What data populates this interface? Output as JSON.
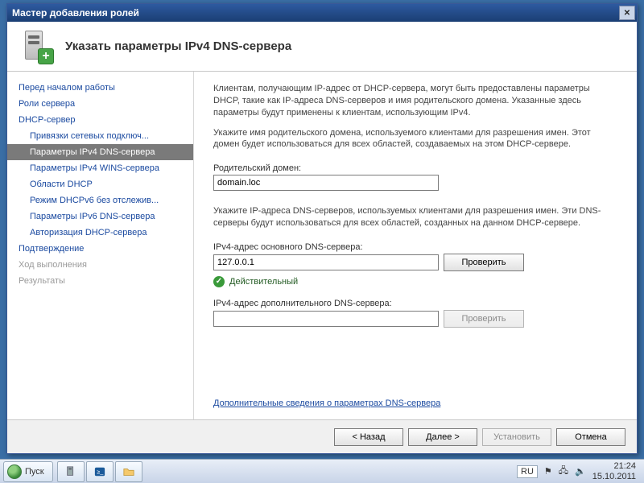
{
  "window": {
    "title": "Мастер добавления ролей",
    "close_glyph": "✕"
  },
  "header": {
    "title": "Указать параметры IPv4 DNS-сервера"
  },
  "sidebar": {
    "items": [
      {
        "label": "Перед началом работы",
        "sub": false
      },
      {
        "label": "Роли сервера",
        "sub": false
      },
      {
        "label": "DHCP-сервер",
        "sub": false
      },
      {
        "label": "Привязки сетевых подключ...",
        "sub": true
      },
      {
        "label": "Параметры IPv4 DNS-сервера",
        "sub": true,
        "selected": true
      },
      {
        "label": "Параметры IPv4 WINS-сервера",
        "sub": true
      },
      {
        "label": "Области DHCP",
        "sub": true
      },
      {
        "label": "Режим DHCPv6 без отслежив...",
        "sub": true
      },
      {
        "label": "Параметры IPv6 DNS-сервера",
        "sub": true
      },
      {
        "label": "Авторизация DHCP-сервера",
        "sub": true
      },
      {
        "label": "Подтверждение",
        "sub": false
      },
      {
        "label": "Ход выполнения",
        "sub": false,
        "disabled": true
      },
      {
        "label": "Результаты",
        "sub": false,
        "disabled": true
      }
    ]
  },
  "content": {
    "para1": "Клиентам, получающим IP-адрес от DHCP-сервера, могут быть предоставлены параметры DHCP, такие как IP-адреса DNS-серверов и имя родительского домена. Указанные здесь параметры будут применены к клиентам, использующим IPv4.",
    "para2": "Укажите имя родительского домена, используемого клиентами для разрешения имен. Этот домен будет использоваться для всех областей, создаваемых на этом DHCP-сервере.",
    "parent_domain_label": "Родительский домен:",
    "parent_domain_value": "domain.loc",
    "para3": "Укажите IP-адреса DNS-серверов, используемых клиентами для разрешения имен. Эти DNS-серверы будут использоваться для всех областей, созданных на данном DHCP-сервере.",
    "primary_label": "IPv4-адрес основного DNS-сервера:",
    "primary_value": "127.0.0.1",
    "verify_label": "Проверить",
    "valid_label": "Действительный",
    "secondary_label": "IPv4-адрес дополнительного DNS-сервера:",
    "secondary_value": "",
    "more_link": "Дополнительные сведения о параметрах DNS-сервера"
  },
  "footer": {
    "back": "< Назад",
    "next": "Далее >",
    "install": "Установить",
    "cancel": "Отмена"
  },
  "taskbar": {
    "start": "Пуск",
    "lang": "RU",
    "time": "21:24",
    "date": "15.10.2011"
  }
}
